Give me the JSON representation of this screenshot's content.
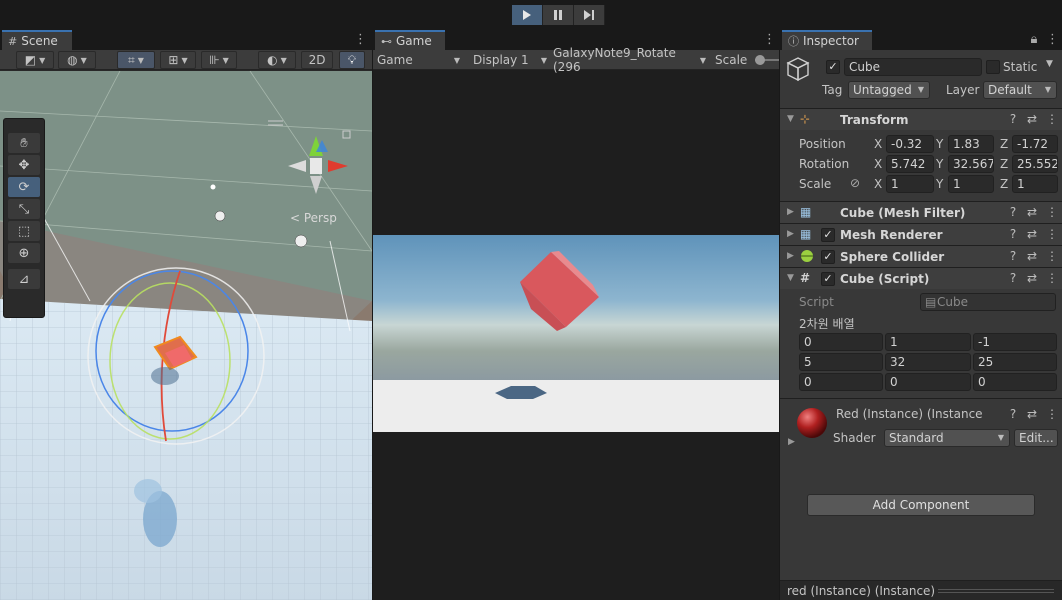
{
  "playbar": {
    "play": "play-button",
    "pause": "pause-button",
    "step": "step-button"
  },
  "scene": {
    "tab_label": "Scene",
    "toolbar": {
      "mode_2d": "2D"
    },
    "persp_label": "< Persp"
  },
  "game": {
    "tab_label": "Game",
    "toolbar": {
      "view": "Game",
      "display": "Display 1",
      "resolution": "GalaxyNote9_Rotate (296",
      "scale_label": "Scale"
    }
  },
  "inspector": {
    "tab_label": "Inspector",
    "object": {
      "name": "Cube",
      "active": true,
      "static_label": "Static",
      "tag_label": "Tag",
      "tag_value": "Untagged",
      "layer_label": "Layer",
      "layer_value": "Default"
    },
    "transform": {
      "title": "Transform",
      "position_label": "Position",
      "rotation_label": "Rotation",
      "scale_label": "Scale",
      "axis_x": "X",
      "axis_y": "Y",
      "axis_z": "Z",
      "position": {
        "x": "-0.32",
        "y": "1.83",
        "z": "-1.72"
      },
      "rotation": {
        "x": "5.742",
        "y": "32.567",
        "z": "25.552"
      },
      "scale": {
        "x": "1",
        "y": "1",
        "z": "1"
      }
    },
    "components": [
      {
        "title": "Cube (Mesh Filter)",
        "has_checkbox": false
      },
      {
        "title": "Mesh Renderer",
        "has_checkbox": true
      },
      {
        "title": "Sphere Collider",
        "has_checkbox": true
      },
      {
        "title": "Cube (Script)",
        "has_checkbox": true
      }
    ],
    "script": {
      "script_label": "Script",
      "script_value": "Cube",
      "array_label": "2차원 배열",
      "rows": [
        [
          "0",
          "1",
          "-1"
        ],
        [
          "5",
          "32",
          "25"
        ],
        [
          "0",
          "0",
          "0"
        ]
      ]
    },
    "material": {
      "name": "Red (Instance) (Instance) (M",
      "shader_label": "Shader",
      "shader_value": "Standard",
      "edit_label": "Edit..."
    },
    "add_component": "Add Component",
    "status": "red (Instance) (Instance)"
  },
  "colors": {
    "accent": "#3a72b0",
    "cube": "#d9585d",
    "sky": "#6fa1c3",
    "ground": "#ededed"
  }
}
